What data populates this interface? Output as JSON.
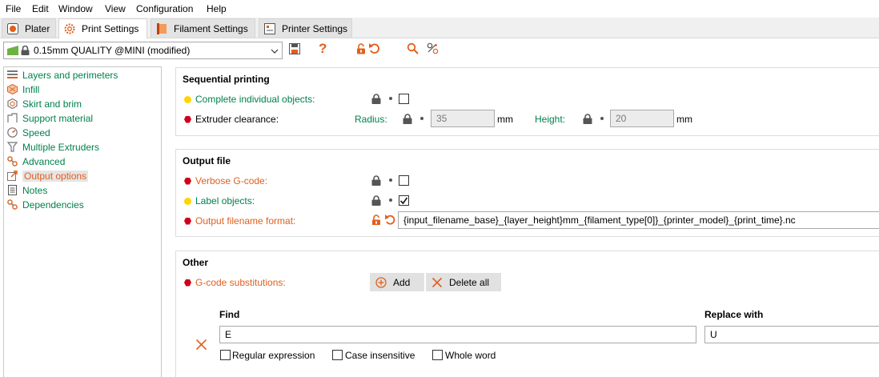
{
  "menu": [
    "File",
    "Edit",
    "Window",
    "View",
    "Configuration",
    "Help"
  ],
  "tabs": [
    {
      "label": "Plater",
      "icon": "plater-icon"
    },
    {
      "label": "Print Settings",
      "icon": "gear-icon"
    },
    {
      "label": "Filament Settings",
      "icon": "filament-icon"
    },
    {
      "label": "Printer Settings",
      "icon": "printer-icon"
    }
  ],
  "toolbar": {
    "preset": "0.15mm QUALITY @MINI (modified)",
    "help": "?"
  },
  "sidebar": {
    "items": [
      {
        "label": "Layers and perimeters"
      },
      {
        "label": "Infill"
      },
      {
        "label": "Skirt and brim"
      },
      {
        "label": "Support material"
      },
      {
        "label": "Speed"
      },
      {
        "label": "Multiple Extruders"
      },
      {
        "label": "Advanced"
      },
      {
        "label": "Output options"
      },
      {
        "label": "Notes"
      },
      {
        "label": "Dependencies"
      }
    ]
  },
  "sequential": {
    "title": "Sequential printing",
    "complete_label": "Complete individual objects:",
    "complete_checked": false,
    "clearance_label": "Extruder clearance:",
    "radius_label": "Radius:",
    "radius_value": "35",
    "height_label": "Height:",
    "height_value": "20",
    "unit": "mm"
  },
  "output": {
    "title": "Output file",
    "verbose_label": "Verbose G-code:",
    "verbose_checked": false,
    "labelobj_label": "Label objects:",
    "labelobj_checked": true,
    "filename_label": "Output filename format:",
    "filename_value": "{input_filename_base}_{layer_height}mm_{filament_type[0]}_{printer_model}_{print_time}.nc"
  },
  "other": {
    "title": "Other",
    "subst_label": "G-code substitutions:",
    "add_label": "Add",
    "delete_all_label": "Delete all",
    "find_header": "Find",
    "replace_header": "Replace with",
    "find_value": "E",
    "replace_value": "U",
    "regex_label": "Regular expression",
    "case_label": "Case insensitive",
    "whole_label": "Whole word"
  },
  "colors": {
    "accent_green": "#00804d",
    "accent_orange": "#e0601e",
    "mark_red": "#d0001c",
    "mark_yellow": "#ffd400"
  }
}
